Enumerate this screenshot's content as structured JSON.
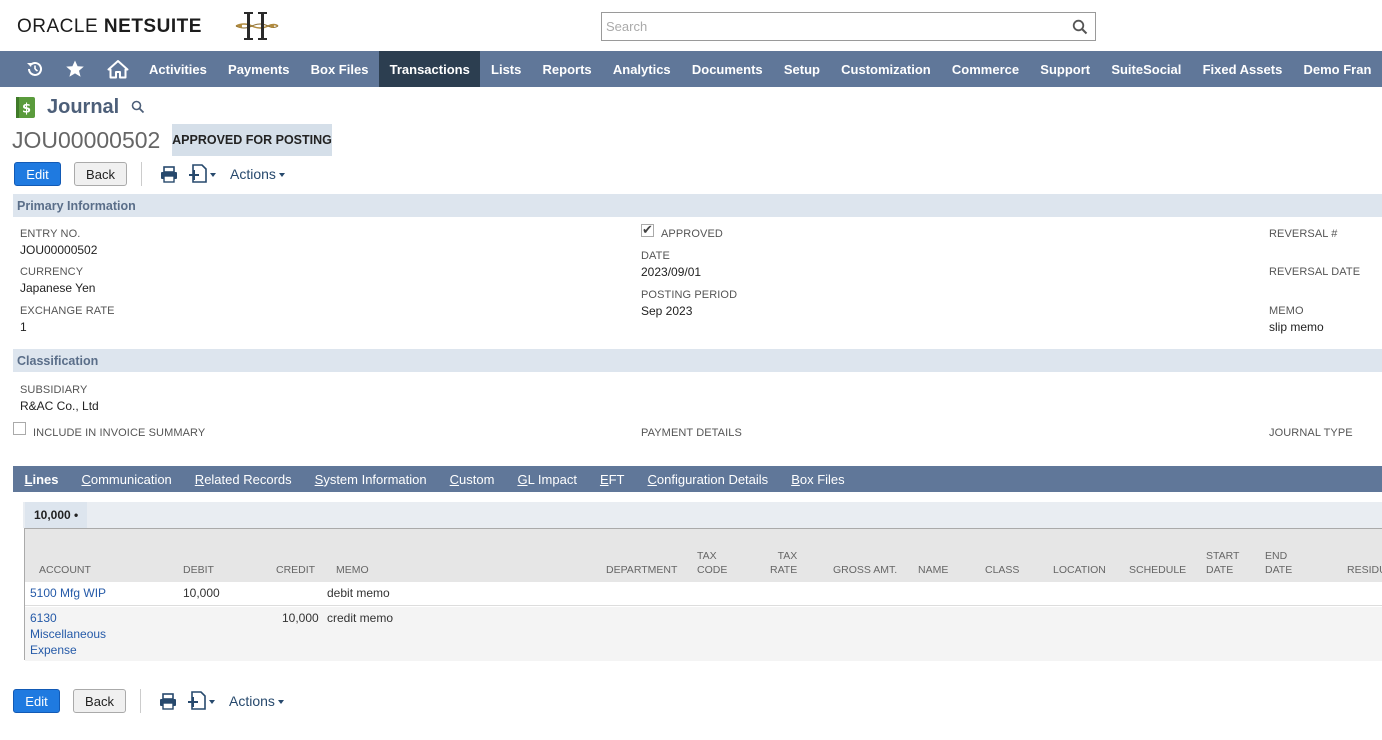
{
  "header": {
    "logo_oracle": "ORACLE ",
    "logo_netsuite": "NETSUITE",
    "search_placeholder": "Search"
  },
  "nav": {
    "items": [
      "Activities",
      "Payments",
      "Box Files",
      "Transactions",
      "Lists",
      "Reports",
      "Analytics",
      "Documents",
      "Setup",
      "Customization",
      "Commerce",
      "Support",
      "SuiteSocial",
      "Fixed Assets",
      "Demo Fran"
    ],
    "active": "Transactions"
  },
  "page": {
    "title": "Journal",
    "record_id": "JOU00000502",
    "status": "APPROVED FOR POSTING"
  },
  "buttons": {
    "edit": "Edit",
    "back": "Back",
    "actions": "Actions"
  },
  "primary": {
    "section_title": "Primary Information",
    "entry_no_label": "ENTRY NO.",
    "entry_no": "JOU00000502",
    "currency_label": "CURRENCY",
    "currency": "Japanese Yen",
    "exchange_rate_label": "EXCHANGE RATE",
    "exchange_rate": "1",
    "approved_label": "APPROVED",
    "date_label": "DATE",
    "date": "2023/09/01",
    "posting_period_label": "POSTING PERIOD",
    "posting_period": "Sep 2023",
    "reversal_no_label": "REVERSAL #",
    "reversal_date_label": "REVERSAL DATE",
    "memo_label": "MEMO",
    "memo": "slip memo"
  },
  "classification": {
    "section_title": "Classification",
    "subsidiary_label": "SUBSIDIARY",
    "subsidiary": "R&AC Co., Ltd",
    "include_invoice_label": "INCLUDE IN INVOICE SUMMARY",
    "payment_details_label": "PAYMENT DETAILS",
    "journal_type_label": "JOURNAL TYPE"
  },
  "subtabs": [
    {
      "first": "L",
      "rest": "ines"
    },
    {
      "first": "C",
      "rest": "ommunication"
    },
    {
      "first": "R",
      "rest": "elated Records"
    },
    {
      "first": "S",
      "rest": "ystem Information"
    },
    {
      "first": "C",
      "rest": "ustom"
    },
    {
      "first": "G",
      "rest": "L Impact"
    },
    {
      "first": "E",
      "rest": "FT"
    },
    {
      "first": "C",
      "rest": "onfiguration Details"
    },
    {
      "first": "B",
      "rest": "ox Files"
    }
  ],
  "lines": {
    "tab_label": "10,000 •",
    "columns": {
      "account": "ACCOUNT",
      "debit": "DEBIT",
      "credit": "CREDIT",
      "memo": "MEMO",
      "department": "DEPARTMENT",
      "tax_code_1": "TAX",
      "tax_code_2": "CODE",
      "tax_rate_1": "TAX",
      "tax_rate_2": "RATE",
      "gross_amt": "GROSS AMT.",
      "name": "NAME",
      "class": "CLASS",
      "location": "LOCATION",
      "schedule": "SCHEDULE",
      "start_date_1": "START",
      "start_date_2": "DATE",
      "end_date_1": "END",
      "end_date_2": "DATE",
      "residual": "RESIDU"
    },
    "rows": [
      {
        "account": "5100 Mfg WIP",
        "debit": "10,000",
        "credit": "",
        "memo": "debit memo"
      },
      {
        "account_1": "6130",
        "account_2": "Miscellaneous",
        "account_3": "Expense",
        "debit": "",
        "credit": "10,000",
        "memo": "credit memo"
      }
    ]
  },
  "colors": {
    "nav_bg": "#607799",
    "nav_active": "#2c3e50",
    "primary_button": "#1f7ae0",
    "section_bg": "#dde5ee"
  }
}
